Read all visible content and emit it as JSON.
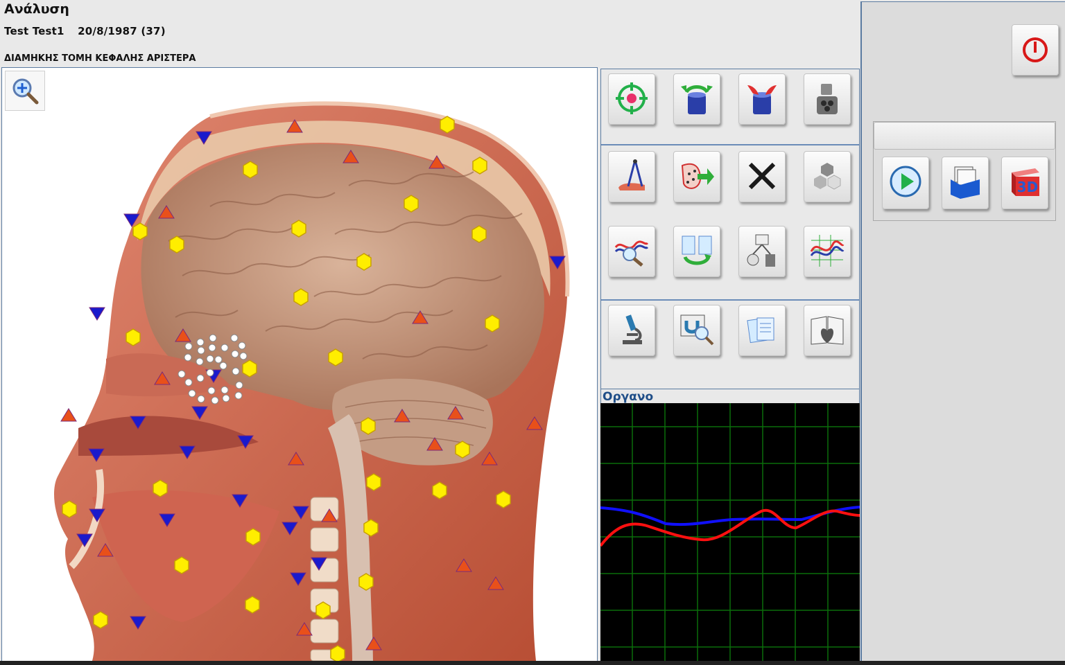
{
  "header": {
    "app_title": "Ανάλυση",
    "patient_name": "Test  Test1",
    "patient_birth": "20/8/1987 (37)",
    "section_title": "ΔΙΑΜΗΚΗΣ ΤΟΜΗ ΚΕΦΑΛΗΣ ΑΡΙΣΤΕΡΑ"
  },
  "view": {
    "zoom_icon": "zoom-in-magnifier-icon",
    "image": "sagittal-head-section-image",
    "marker_types": [
      "yellow-hexagon",
      "blue-down-triangle",
      "orange-up-triangle",
      "white-dot-cluster"
    ],
    "colors": {
      "hexagon": "#ffee00",
      "down_triangle": "#1a1acc",
      "up_triangle": "#e8501a"
    }
  },
  "toolbar": {
    "buttons": [
      "target-scan-icon",
      "export-container-icon",
      "import-container-icon",
      "grinder-icon",
      "compass-foot-icon",
      "body-dots-arrow-icon",
      "close-x-icon",
      "cubes-icon",
      "wave-search-icon",
      "documents-cycle-icon",
      "organ-network-icon",
      "multi-wave-chart-icon",
      "microscope-icon",
      "magnet-search-icon",
      "documents-icon",
      "book-heart-icon"
    ]
  },
  "organ": {
    "label": "Οργανο",
    "colors": {
      "background": "#000000",
      "grid": "#0a6e0a",
      "blue_line": "#1010ff",
      "red_line": "#ff1010"
    }
  },
  "right_panel": {
    "power_icon": "power-icon",
    "field_value": "",
    "buttons": [
      "play-icon",
      "folder-files-icon",
      "3d-icon"
    ],
    "three_d_label": "3D"
  }
}
